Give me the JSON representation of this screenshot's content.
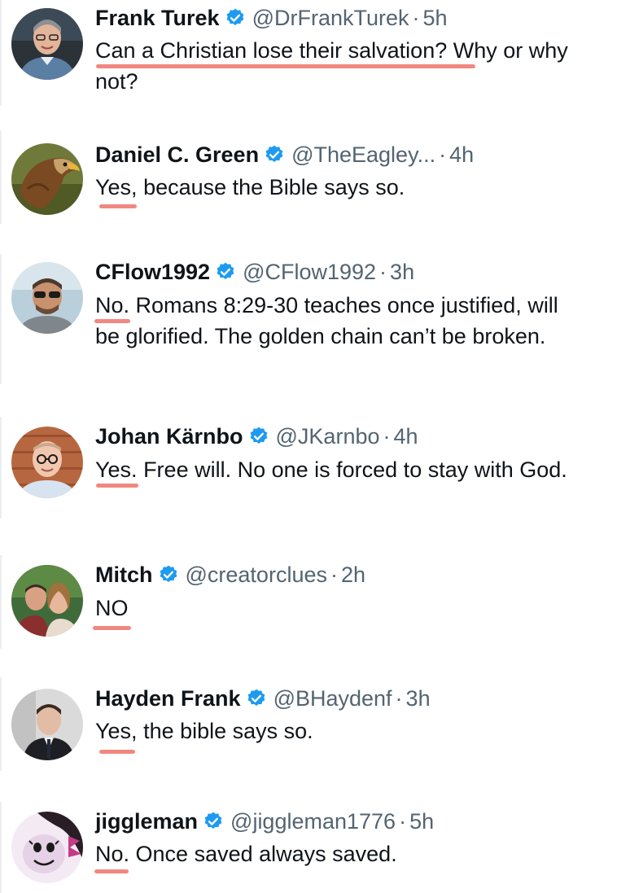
{
  "colors": {
    "highlight": "#ef7b72",
    "verified": "#1d9bf0",
    "muted": "#536471",
    "text": "#0f1419"
  },
  "tweets": [
    {
      "name": "Frank Turek",
      "handle": "@DrFrankTurek",
      "dot": "·",
      "time": "5h",
      "verified": true,
      "avatar": "avatar-photo",
      "text_first": "Can a Christian lose their salvation?",
      "text_rest": " Why or why not?"
    },
    {
      "name": "Daniel C. Green",
      "handle": "@TheEagley...",
      "dot": "·",
      "time": "4h",
      "verified": true,
      "avatar": "eagle-avatar",
      "text_first": "Yes,",
      "text_rest": " because the Bible says so."
    },
    {
      "name": "CFlow1992",
      "handle": "@CFlow1992",
      "dot": "·",
      "time": "3h",
      "verified": true,
      "avatar": "avatar-photo",
      "text_first": "No.",
      "text_rest": " Romans 8:29-30 teaches once justified, will be glorified. The golden chain can’t be broken."
    },
    {
      "name": "Johan Kärnbo",
      "handle": "@JKarnbo",
      "dot": "·",
      "time": "4h",
      "verified": true,
      "avatar": "avatar-photo",
      "text_first": "Yes.",
      "text_rest": " Free will. No one is forced to stay with God."
    },
    {
      "name": "Mitch",
      "handle": "@creatorclues",
      "dot": "·",
      "time": "2h",
      "verified": true,
      "avatar": "couple-avatar",
      "text_first": "NO",
      "text_rest": ""
    },
    {
      "name": "Hayden Frank",
      "handle": "@BHaydenf",
      "dot": "·",
      "time": "3h",
      "verified": true,
      "avatar": "avatar-photo",
      "text_first": "Yes,",
      "text_rest": " the bible says so."
    },
    {
      "name": "jiggleman",
      "handle": "@jiggleman1776",
      "dot": "·",
      "time": "5h",
      "verified": true,
      "avatar": "cartoon-avatar",
      "text_first": "No.",
      "text_rest": " Once saved always saved."
    }
  ]
}
